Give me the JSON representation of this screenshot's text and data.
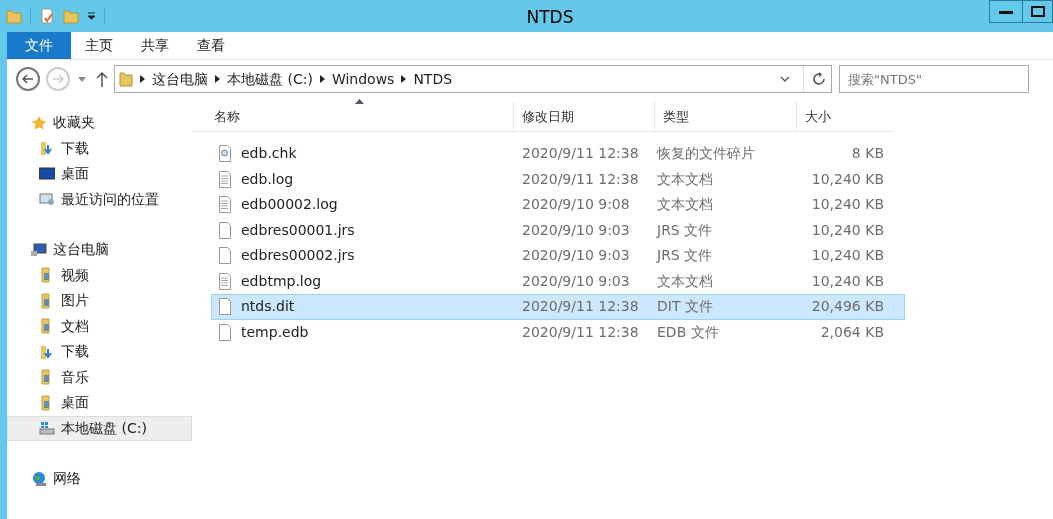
{
  "window": {
    "title": "NTDS"
  },
  "ribbon_tabs": [
    {
      "label": "文件",
      "selected": true
    },
    {
      "label": "主页",
      "selected": false
    },
    {
      "label": "共享",
      "selected": false
    },
    {
      "label": "查看",
      "selected": false
    }
  ],
  "breadcrumb": [
    "这台电脑",
    "本地磁盘 (C:)",
    "Windows",
    "NTDS"
  ],
  "search": {
    "placeholder": "搜索\"NTDS\""
  },
  "sidebar": [
    {
      "label": "收藏夹",
      "kind": "star",
      "selected": false,
      "children": [
        {
          "label": "下载",
          "kind": "download",
          "selected": false
        },
        {
          "label": "桌面",
          "kind": "desktop",
          "selected": false
        },
        {
          "label": "最近访问的位置",
          "kind": "recent",
          "selected": false
        }
      ]
    },
    {
      "label": "这台电脑",
      "kind": "pc",
      "selected": false,
      "children": [
        {
          "label": "视频",
          "kind": "folder",
          "selected": false
        },
        {
          "label": "图片",
          "kind": "folder",
          "selected": false
        },
        {
          "label": "文档",
          "kind": "folder",
          "selected": false
        },
        {
          "label": "下载",
          "kind": "download",
          "selected": false
        },
        {
          "label": "音乐",
          "kind": "folder",
          "selected": false
        },
        {
          "label": "桌面",
          "kind": "folder",
          "selected": false
        },
        {
          "label": "本地磁盘 (C:)",
          "kind": "drive",
          "selected": true
        }
      ]
    },
    {
      "label": "网络",
      "kind": "network",
      "selected": false
    }
  ],
  "table": {
    "columns": [
      "名称",
      "修改日期",
      "类型",
      "大小"
    ],
    "rows": [
      {
        "name": "edb.chk",
        "kind": "chk",
        "date": "2020/9/11 12:38",
        "type": "恢复的文件碎片",
        "size": "8 KB",
        "selected": false
      },
      {
        "name": "edb.log",
        "kind": "text",
        "date": "2020/9/11 12:38",
        "type": "文本文档",
        "size": "10,240 KB",
        "selected": false
      },
      {
        "name": "edb00002.log",
        "kind": "text",
        "date": "2020/9/10 9:08",
        "type": "文本文档",
        "size": "10,240 KB",
        "selected": false
      },
      {
        "name": "edbres00001.jrs",
        "kind": "blank",
        "date": "2020/9/10 9:03",
        "type": "JRS 文件",
        "size": "10,240 KB",
        "selected": false
      },
      {
        "name": "edbres00002.jrs",
        "kind": "blank",
        "date": "2020/9/10 9:03",
        "type": "JRS 文件",
        "size": "10,240 KB",
        "selected": false
      },
      {
        "name": "edbtmp.log",
        "kind": "text",
        "date": "2020/9/10 9:03",
        "type": "文本文档",
        "size": "10,240 KB",
        "selected": false
      },
      {
        "name": "ntds.dit",
        "kind": "blank",
        "date": "2020/9/11 12:38",
        "type": "DIT 文件",
        "size": "20,496 KB",
        "selected": true
      },
      {
        "name": "temp.edb",
        "kind": "blank",
        "date": "2020/9/11 12:38",
        "type": "EDB 文件",
        "size": "2,064 KB",
        "selected": false
      }
    ]
  }
}
